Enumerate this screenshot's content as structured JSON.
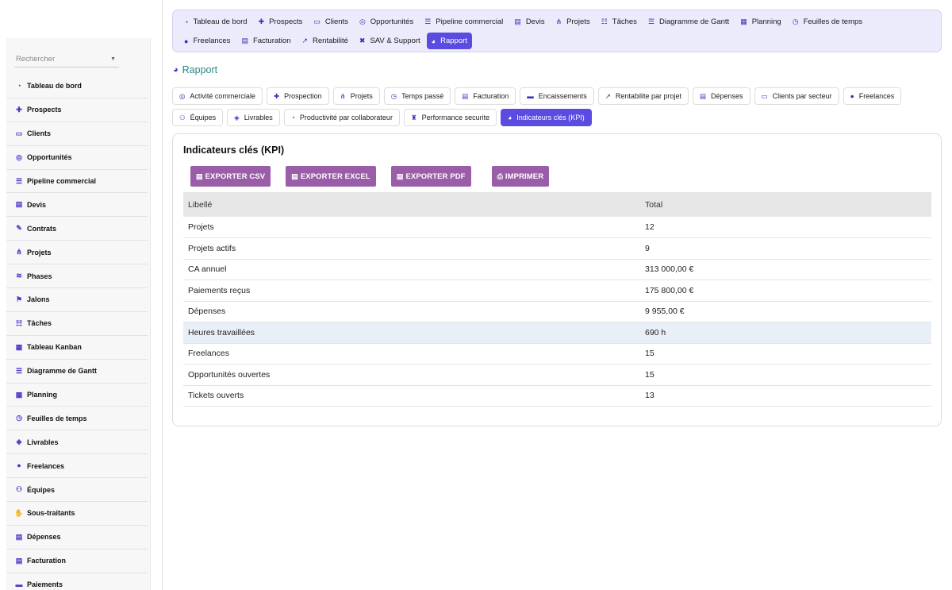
{
  "sidebar": {
    "search_placeholder": "Rechercher",
    "items": [
      {
        "label": "Tableau de bord",
        "icon": "gauge-icon"
      },
      {
        "label": "Prospects",
        "icon": "user-plus-icon"
      },
      {
        "label": "Clients",
        "icon": "id-card-icon"
      },
      {
        "label": "Opportunités",
        "icon": "target-icon"
      },
      {
        "label": "Pipeline commercial",
        "icon": "bars-icon"
      },
      {
        "label": "Devis",
        "icon": "document-icon"
      },
      {
        "label": "Contrats",
        "icon": "signature-icon"
      },
      {
        "label": "Projets",
        "icon": "sitemap-icon"
      },
      {
        "label": "Phases",
        "icon": "layers-icon"
      },
      {
        "label": "Jalons",
        "icon": "flag-icon"
      },
      {
        "label": "Tâches",
        "icon": "list-check-icon"
      },
      {
        "label": "Tableau Kanban",
        "icon": "kanban-icon"
      },
      {
        "label": "Diagramme de Gantt",
        "icon": "bars-icon"
      },
      {
        "label": "Planning",
        "icon": "calendar-icon"
      },
      {
        "label": "Feuilles de temps",
        "icon": "clock-icon"
      },
      {
        "label": "Livrables",
        "icon": "box-icon"
      },
      {
        "label": "Freelances",
        "icon": "user-icon"
      },
      {
        "label": "Équipes",
        "icon": "users-icon"
      },
      {
        "label": "Sous-traitants",
        "icon": "handshake-icon"
      },
      {
        "label": "Dépenses",
        "icon": "receipt-icon"
      },
      {
        "label": "Facturation",
        "icon": "invoice-icon"
      },
      {
        "label": "Paiements",
        "icon": "money-icon"
      }
    ]
  },
  "topnav": {
    "row1": [
      {
        "label": "Tableau de bord",
        "icon": "gauge-icon"
      },
      {
        "label": "Prospects",
        "icon": "user-plus-icon"
      },
      {
        "label": "Clients",
        "icon": "id-card-icon"
      },
      {
        "label": "Opportunités",
        "icon": "target-icon"
      },
      {
        "label": "Pipeline commercial",
        "icon": "bars-icon"
      },
      {
        "label": "Devis",
        "icon": "document-icon"
      },
      {
        "label": "Projets",
        "icon": "sitemap-icon"
      },
      {
        "label": "Tâches",
        "icon": "list-check-icon"
      },
      {
        "label": "Diagramme de Gantt",
        "icon": "bars-icon"
      },
      {
        "label": "Planning",
        "icon": "calendar-icon"
      },
      {
        "label": "Feuilles de temps",
        "icon": "clock-icon"
      }
    ],
    "row2": [
      {
        "label": "Freelances",
        "icon": "user-icon"
      },
      {
        "label": "Facturation",
        "icon": "invoice-icon"
      },
      {
        "label": "Rentabilité",
        "icon": "chart-line-icon"
      },
      {
        "label": "SAV & Support",
        "icon": "support-icon"
      },
      {
        "label": "Rapport",
        "icon": "pie-chart-icon",
        "active": true
      }
    ]
  },
  "page": {
    "title": "Rapport"
  },
  "report_tabs": {
    "row1": [
      {
        "label": "Activité commerciale",
        "icon": "target-icon"
      },
      {
        "label": "Prospection",
        "icon": "user-plus-icon"
      },
      {
        "label": "Projets",
        "icon": "sitemap-icon"
      },
      {
        "label": "Temps passé",
        "icon": "clock-icon"
      },
      {
        "label": "Facturation",
        "icon": "invoice-icon"
      },
      {
        "label": "Encaissements",
        "icon": "money-icon"
      },
      {
        "label": "Rentabilite par projet",
        "icon": "chart-line-icon"
      },
      {
        "label": "Dépenses",
        "icon": "receipt-icon"
      },
      {
        "label": "Clients par secteur",
        "icon": "id-card-icon"
      },
      {
        "label": "Freelances",
        "icon": "user-icon"
      }
    ],
    "row2": [
      {
        "label": "Équipes",
        "icon": "users-icon"
      },
      {
        "label": "Livrables",
        "icon": "box-icon"
      },
      {
        "label": "Productivité par collaborateur",
        "icon": "gauge-icon"
      },
      {
        "label": "Performance securite",
        "icon": "trophy-icon"
      },
      {
        "label": "Indicateurs clés (KPI)",
        "icon": "pie-chart-icon",
        "active": true
      }
    ]
  },
  "panel": {
    "title": "Indicateurs clés (KPI)",
    "export": {
      "csv": "EXPORTER CSV",
      "excel": "EXPORTER EXCEL",
      "pdf": "EXPORTER PDF",
      "print": "IMPRIMER"
    },
    "table": {
      "headers": [
        "Libellé",
        "Total"
      ],
      "rows": [
        {
          "label": "Projets",
          "total": "12"
        },
        {
          "label": "Projets actifs",
          "total": "9"
        },
        {
          "label": "CA annuel",
          "total": "313 000,00 €"
        },
        {
          "label": "Paiements reçus",
          "total": "175 800,00 €"
        },
        {
          "label": "Dépenses",
          "total": "9 955,00 €"
        },
        {
          "label": "Heures travaillées",
          "total": "690 h",
          "highlighted": true
        },
        {
          "label": "Freelances",
          "total": "15"
        },
        {
          "label": "Opportunités ouvertes",
          "total": "15"
        },
        {
          "label": "Tickets ouverts",
          "total": "13"
        }
      ]
    }
  },
  "colors": {
    "accent": "#5b4be0",
    "export_button": "#9a5ea9",
    "title_teal": "#28867f",
    "nav_bg": "#ecebfb"
  }
}
